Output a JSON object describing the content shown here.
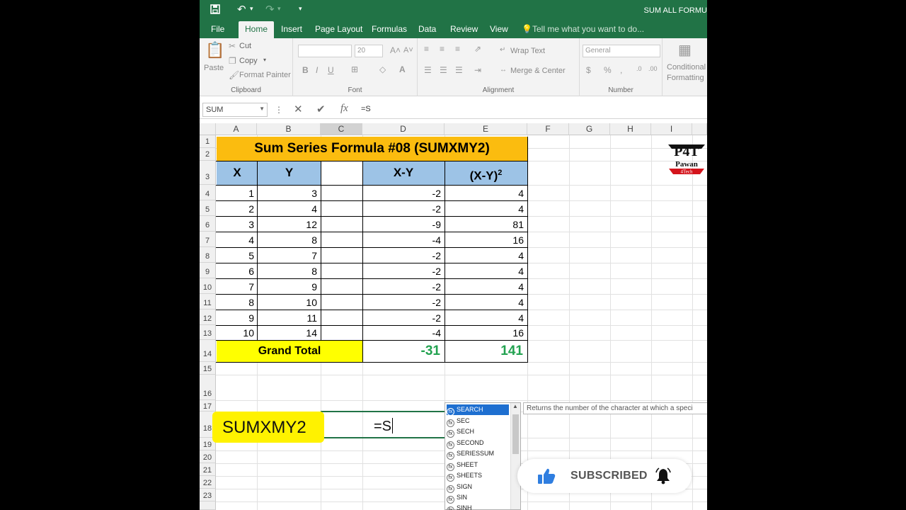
{
  "titlebar": {
    "doc_title": "SUM ALL FORMU"
  },
  "tabs": [
    "File",
    "Home",
    "Insert",
    "Page Layout",
    "Formulas",
    "Data",
    "Review",
    "View"
  ],
  "tell_me": "Tell me what you want to do...",
  "ribbon": {
    "paste": "Paste",
    "cut": "Cut",
    "copy": "Copy",
    "format_painter": "Format Painter",
    "clipboard": "Clipboard",
    "font_size": "20",
    "font": "Font",
    "wrap_text": "Wrap Text",
    "merge_center": "Merge & Center",
    "alignment": "Alignment",
    "number_format": "General",
    "number": "Number",
    "conditional": "Conditional",
    "formatting": "Formatting"
  },
  "formula_bar": {
    "name_box": "SUM",
    "formula": "=S"
  },
  "columns": [
    "A",
    "B",
    "C",
    "D",
    "E",
    "F",
    "G",
    "H",
    "I"
  ],
  "rows": [
    "1",
    "2",
    "3",
    "4",
    "5",
    "6",
    "7",
    "8",
    "9",
    "10",
    "11",
    "12",
    "13",
    "14",
    "15",
    "16",
    "17",
    "18",
    "19",
    "20",
    "21",
    "22",
    "23"
  ],
  "sheet": {
    "title": "Sum Series Formula #08 (SUMXMY2)",
    "headers": {
      "x": "X",
      "y": "Y",
      "xy": "X-Y",
      "xy2": "(X-Y)",
      "sup": "2"
    },
    "data": [
      {
        "x": "1",
        "y": "3",
        "d": "-2",
        "e": "4"
      },
      {
        "x": "2",
        "y": "4",
        "d": "-2",
        "e": "4"
      },
      {
        "x": "3",
        "y": "12",
        "d": "-9",
        "e": "81"
      },
      {
        "x": "4",
        "y": "8",
        "d": "-4",
        "e": "16"
      },
      {
        "x": "5",
        "y": "7",
        "d": "-2",
        "e": "4"
      },
      {
        "x": "6",
        "y": "8",
        "d": "-2",
        "e": "4"
      },
      {
        "x": "7",
        "y": "9",
        "d": "-2",
        "e": "4"
      },
      {
        "x": "8",
        "y": "10",
        "d": "-2",
        "e": "4"
      },
      {
        "x": "9",
        "y": "11",
        "d": "-2",
        "e": "4"
      },
      {
        "x": "10",
        "y": "14",
        "d": "-4",
        "e": "16"
      }
    ],
    "grand_total_label": "Grand Total",
    "total_d": "-31",
    "total_e": "141"
  },
  "overlay": {
    "function_label": "SUMXMY2",
    "typed": "=S"
  },
  "autocomplete": {
    "items": [
      "SEARCH",
      "SEC",
      "SECH",
      "SECOND",
      "SERIESSUM",
      "SHEET",
      "SHEETS",
      "SIGN",
      "SIN",
      "SINH"
    ],
    "selected": "SEARCH",
    "tooltip": "Returns the number of the character at which a speci"
  },
  "subscribe": {
    "label": "SUBSCRIBED"
  },
  "logo": {
    "mark": "P4T",
    "name": "Pawan",
    "sub": "4Tech"
  },
  "colors": {
    "excel_green": "#217346",
    "title_fill": "#fbbc0f",
    "header_fill": "#9dc3e6",
    "total_fill": "#ffff00",
    "total_text": "#22a250",
    "label_fill": "#fff200"
  }
}
